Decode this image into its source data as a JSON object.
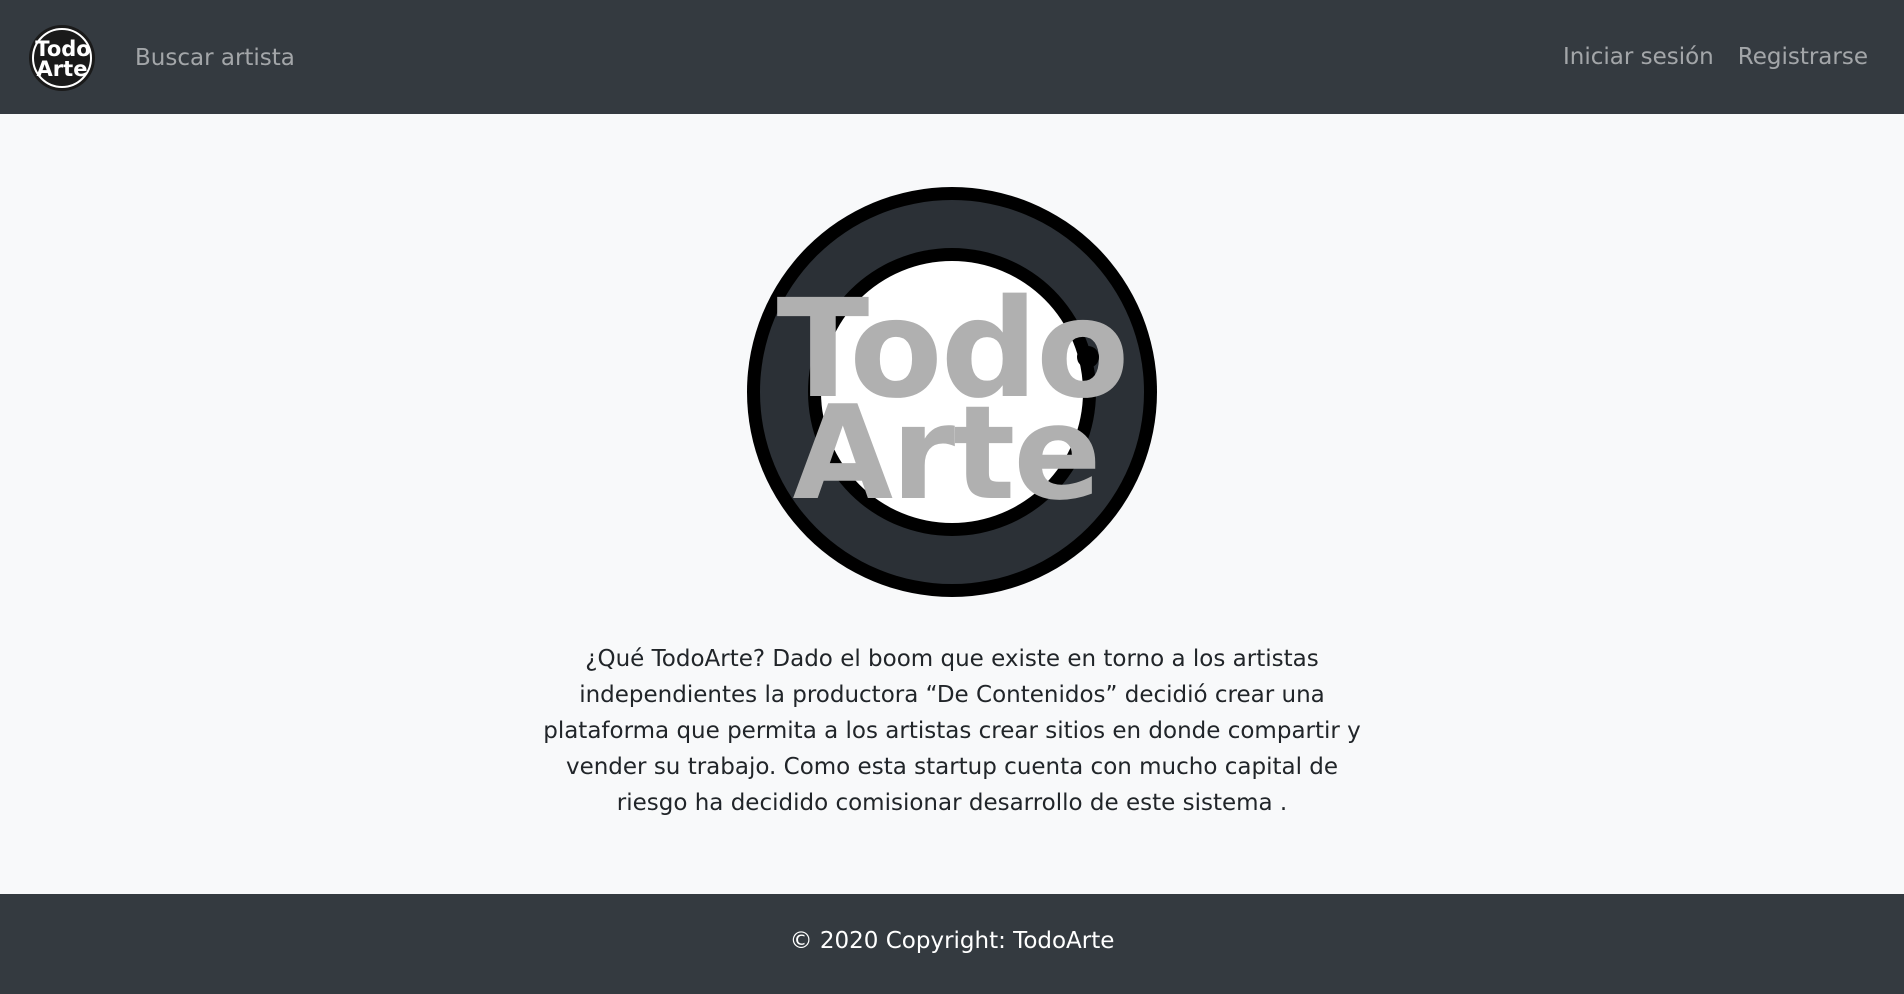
{
  "navbar": {
    "logo": {
      "line1": "Todo",
      "line2": "Arte"
    },
    "search_label": "Buscar artista",
    "login_label": "Iniciar sesión",
    "register_label": "Registrarse"
  },
  "hero": {
    "logo": {
      "line1": "Todo",
      "line2": "Arte"
    },
    "description": "¿Qué TodoArte? Dado el boom que existe en torno a los artistas independientes la productora “De Contenidos” decidió crear una plataforma que permita a los artistas crear sitios en donde compartir y vender su trabajo. Como esta startup cuenta con mucho capital de riesgo ha decidido comisionar desarrollo de este sistema ."
  },
  "footer": {
    "copyright": "© 2020 Copyright: TodoArte"
  },
  "colors": {
    "navbar_bg": "#343a40",
    "page_bg": "#f8f9fa",
    "logo_ring": "#2b3036",
    "logo_text": "#b0b0b0"
  }
}
